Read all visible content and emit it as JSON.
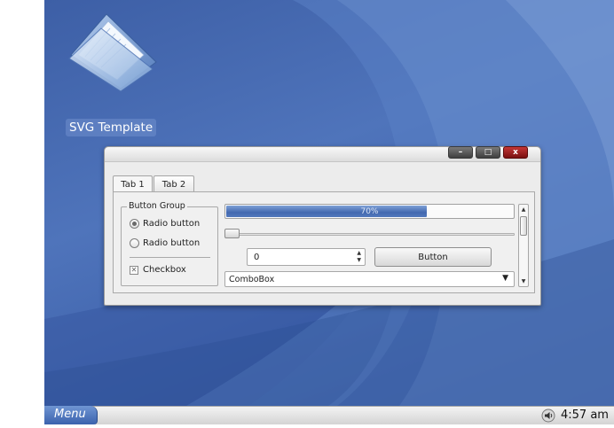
{
  "desktop": {
    "icon_label": "SVG Template"
  },
  "window": {
    "buttons": {
      "minimize": "–",
      "maximize": "□",
      "close": "x"
    },
    "tabs": [
      {
        "label": "Tab 1",
        "active": true
      },
      {
        "label": "Tab 2",
        "active": false
      }
    ],
    "group": {
      "title": "Button Group",
      "radios": [
        {
          "label": "Radio button",
          "checked": true
        },
        {
          "label": "Radio button",
          "checked": false
        }
      ],
      "checkbox": {
        "label": "Checkbox",
        "checked": true,
        "mark": "✕"
      }
    },
    "progress": {
      "value": 0.7,
      "text": "70%"
    },
    "slider": {
      "value": 0
    },
    "spinbox": {
      "value": "0",
      "arrows": "▲\n▼"
    },
    "button_label": "Button",
    "combobox": {
      "value": "ComboBox",
      "arrow": "▼"
    },
    "scrollbar": {
      "up": "▲",
      "down": "▼"
    }
  },
  "taskbar": {
    "menu_label": "Menu",
    "clock": "4:57 am"
  },
  "colors": {
    "desktop_blue": "#4f74bb",
    "progress_fill": "#4369b0",
    "close_red": "#a02020"
  }
}
